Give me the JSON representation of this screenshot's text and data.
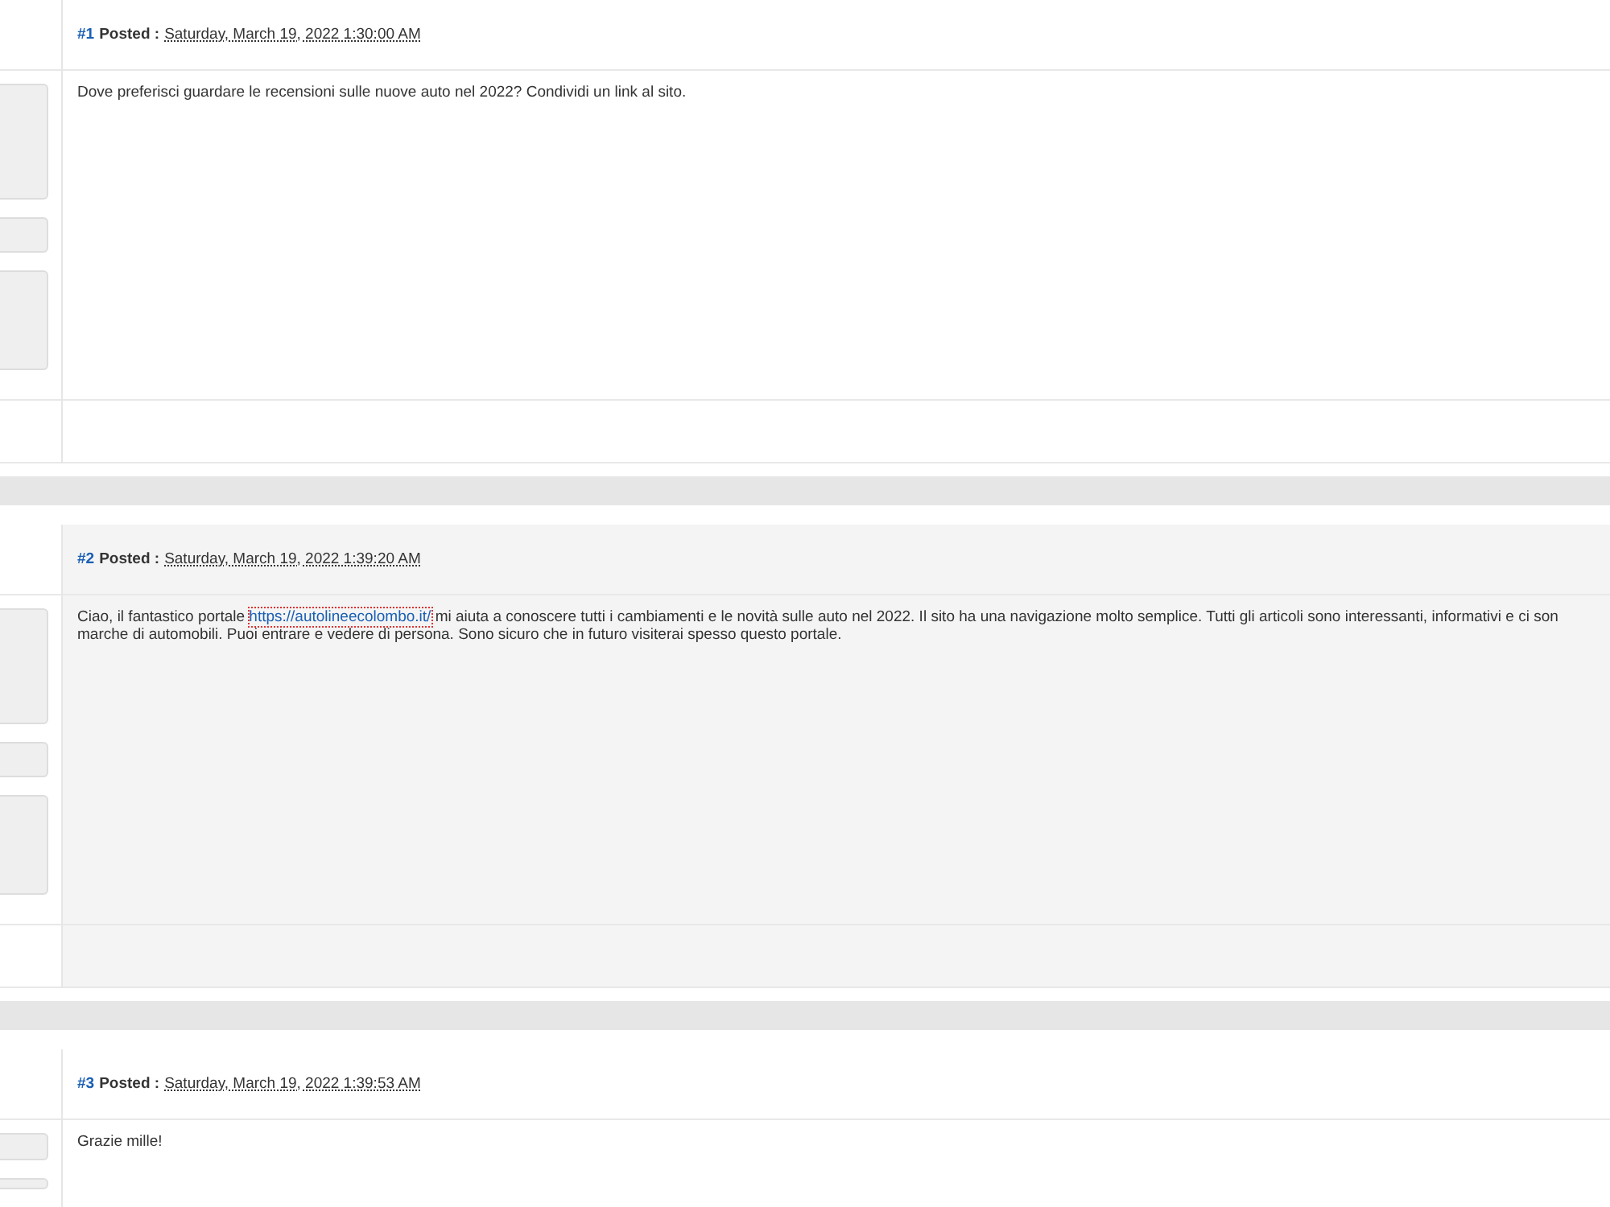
{
  "posts": [
    {
      "number": "#1",
      "posted_label": "Posted :",
      "date": "Saturday, March 19, 2022 1:30:00 AM",
      "body": {
        "text": "Dove preferisci guardare le recensioni sulle nuove auto nel 2022? Condividi un link al sito."
      }
    },
    {
      "number": "#2",
      "posted_label": "Posted :",
      "date": "Saturday, March 19, 2022 1:39:20 AM",
      "body": {
        "text": "Ciao, il fantastico portale",
        "link": "https://autolineecolombo.it/",
        "after": "mi aiuta a conoscere tutti i cambiamenti e le novità sulle auto nel 2022. Il sito ha una navigazione molto semplice. Tutti gli articoli sono interessanti, informativi e ci son",
        "continuation": "marche di automobili. Puoi entrare e vedere di persona. Sono sicuro che in futuro visiterai spesso questo portale."
      }
    },
    {
      "number": "#3",
      "posted_label": "Posted :",
      "date": "Saturday, March 19, 2022 1:39:53 AM",
      "body": {
        "text": "Grazie mille!"
      }
    }
  ]
}
